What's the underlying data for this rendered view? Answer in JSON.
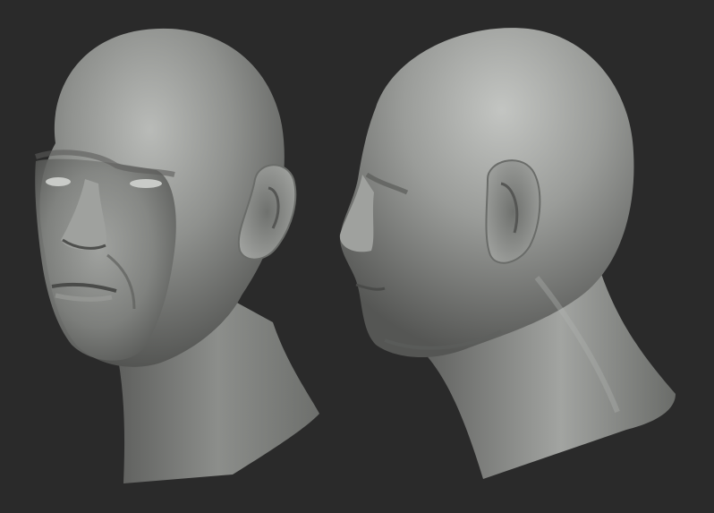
{
  "scene": {
    "background_color": "#2a2a2a",
    "sculpt_color": "#8a8c8a",
    "views": [
      {
        "view": "three-quarter"
      },
      {
        "view": "profile"
      }
    ]
  }
}
